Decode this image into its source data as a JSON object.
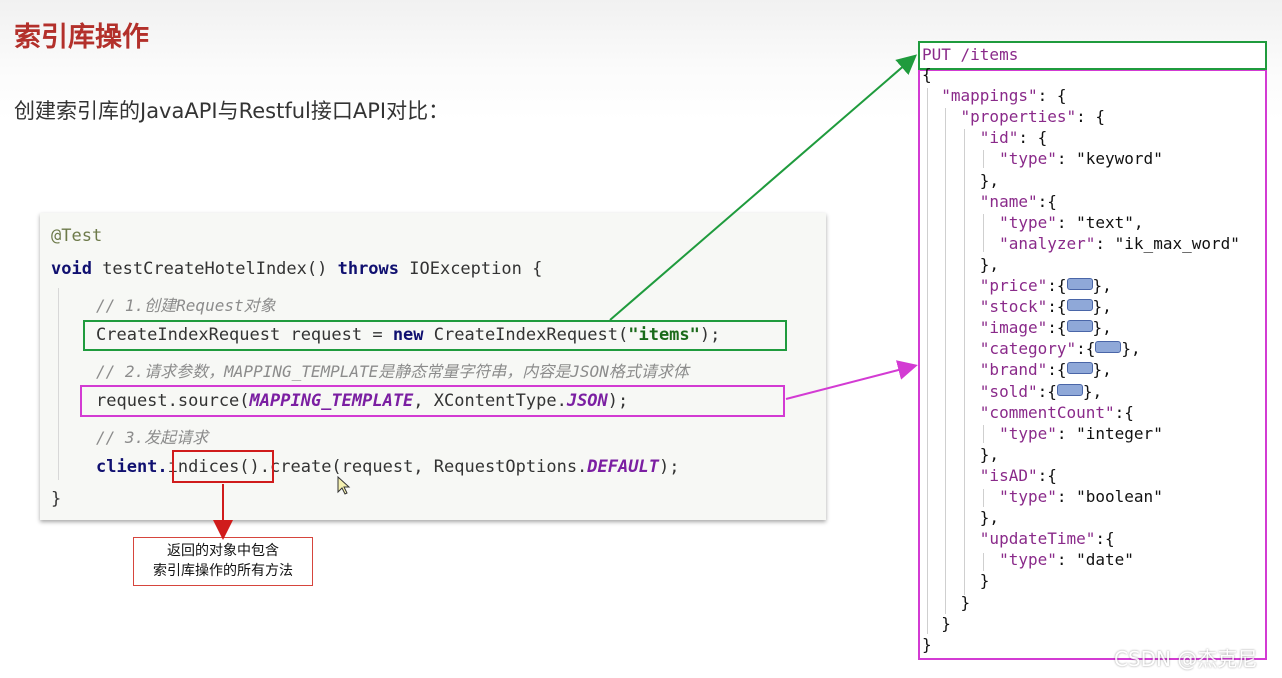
{
  "slide": {
    "title": "索引库操作",
    "subtitle": "创建索引库的JavaAPI与Restful接口API对比："
  },
  "java_code": {
    "annotation": "@Test",
    "signature_void": "void",
    "signature_method": " testCreateHotelIndex() ",
    "signature_throws": "throws",
    "signature_rest": " IOException {",
    "comment1": "// 1.创建Request对象",
    "line1_a": "CreateIndexRequest request = ",
    "line1_new": "new",
    "line1_b": " CreateIndexRequest(",
    "line1_str": "\"items\"",
    "line1_c": ");",
    "comment2": "// 2.请求参数，MAPPING_TEMPLATE是静态常量字符串，内容是JSON格式请求体",
    "line2_a": "request.source(",
    "line2_const1": "MAPPING_TEMPLATE",
    "line2_b": ", XContentType.",
    "line2_const2": "JSON",
    "line2_c": ");",
    "comment3": "// 3.发起请求",
    "line3_a": "client.",
    "line3_b": "indices()",
    "line3_c": ".create(request, RequestOptions.",
    "line3_const": "DEFAULT",
    "line3_d": ");",
    "closing": "}"
  },
  "callout": {
    "line1": "返回的对象中包含",
    "line2": "索引库操作的所有方法"
  },
  "rest": {
    "request_line": "PUT /items",
    "body_lines": [
      "{",
      "  \"mappings\": {",
      "    \"properties\": {",
      "      \"id\": {",
      "        \"type\": \"keyword\"",
      "      },",
      "      \"name\":{",
      "        \"type\": \"text\",",
      "        \"analyzer\": \"ik_max_word\"",
      "      },",
      "      \"price\":{",
      "      \"stock\":{",
      "      \"image\":{",
      "      \"category\":{",
      "      \"brand\":{",
      "      \"sold\":{",
      "      \"commentCount\":{",
      "        \"type\": \"integer\"",
      "      },",
      "      \"isAD\":{",
      "        \"type\": \"boolean\"",
      "      },",
      "      \"updateTime\":{",
      "        \"type\": \"date\"",
      "      }",
      "    }",
      "  }",
      "}"
    ],
    "collapsed_suffix": "},"
  },
  "watermark": "CSDN @杰克尼",
  "colors": {
    "title_red": "#b3302b",
    "green_box": "#1f9b3d",
    "pink_box": "#d33bd3",
    "red_box": "#d01c1c"
  }
}
